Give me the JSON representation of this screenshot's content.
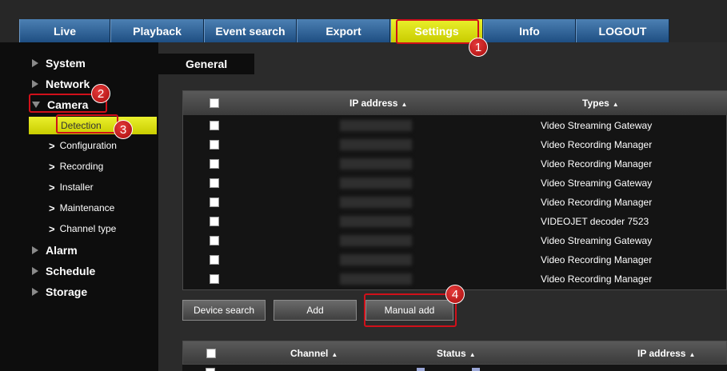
{
  "nav": {
    "items": [
      {
        "label": "Live",
        "width": 114
      },
      {
        "label": "Playback",
        "width": 117
      },
      {
        "label": "Event search",
        "width": 116
      },
      {
        "label": "Export",
        "width": 117
      },
      {
        "label": "Settings",
        "width": 116,
        "active": true
      },
      {
        "label": "Info",
        "width": 116
      },
      {
        "label": "LOGOUT",
        "width": 117
      }
    ]
  },
  "sidebar": {
    "items": [
      {
        "label": "System"
      },
      {
        "label": "Network"
      },
      {
        "label": "Camera"
      },
      {
        "label": "Alarm"
      },
      {
        "label": "Schedule"
      },
      {
        "label": "Storage"
      }
    ],
    "camera_sub": {
      "selected": "Detection",
      "items": [
        "Configuration",
        "Recording",
        "Installer",
        "Maintenance",
        "Channel type"
      ]
    }
  },
  "main": {
    "tab_label": "General",
    "device_table": {
      "col_ip": "IP address",
      "col_types": "Types",
      "rows": [
        "Video Streaming Gateway",
        "Video Recording Manager",
        "Video Recording Manager",
        "Video Streaming Gateway",
        "Video Recording Manager",
        "VIDEOJET decoder 7523",
        "Video Streaming Gateway",
        "Video Recording Manager",
        "Video Recording Manager"
      ]
    },
    "buttons": {
      "device_search": "Device search",
      "add": "Add",
      "manual_add": "Manual add"
    },
    "channel_table": {
      "col_channel": "Channel",
      "col_status": "Status",
      "col_ip": "IP address"
    }
  },
  "annotations": [
    "1",
    "2",
    "3",
    "4"
  ],
  "colors": {
    "accent_yellow": "#d9dd10",
    "nav_blue": "#2a5b8f",
    "annotation_red": "#d0101a"
  },
  "sort_glyph": "▲"
}
